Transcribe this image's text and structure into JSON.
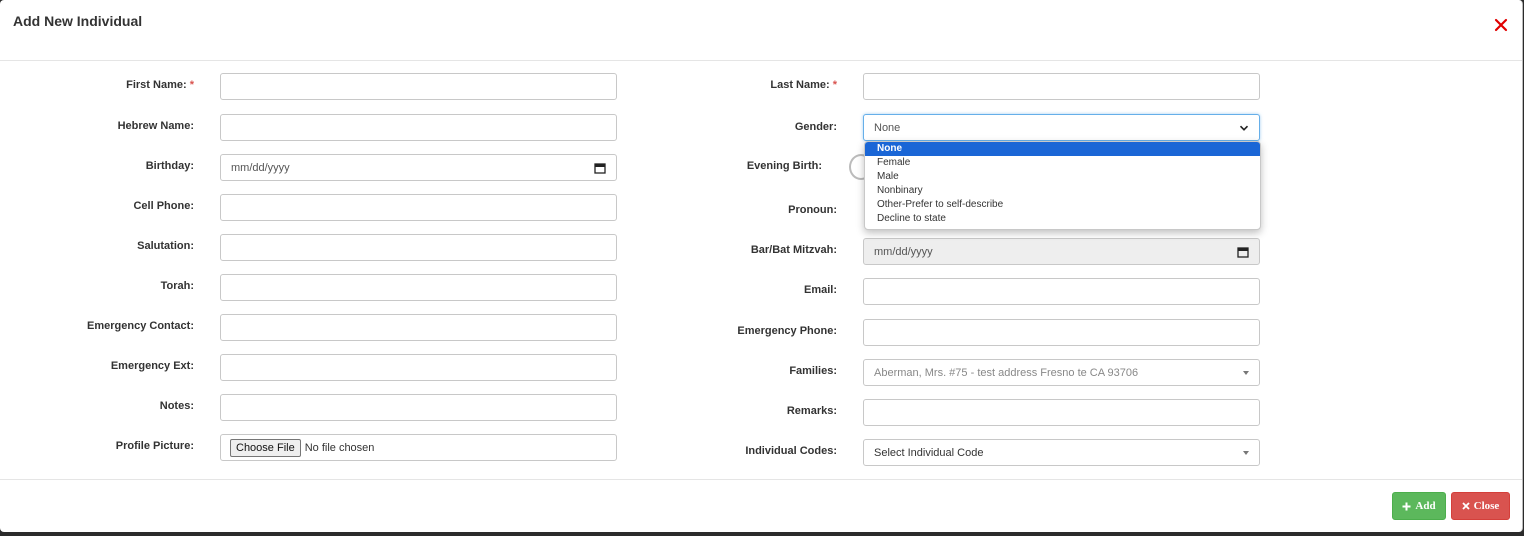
{
  "modal": {
    "title": "Add New Individual",
    "required_mark": "*"
  },
  "left_fields": {
    "first_name": {
      "label": "First Name:",
      "value": ""
    },
    "hebrew_name": {
      "label": "Hebrew Name:",
      "value": ""
    },
    "birthday": {
      "label": "Birthday:",
      "placeholder": "mm/dd/yyyy"
    },
    "cell_phone": {
      "label": "Cell Phone:",
      "value": ""
    },
    "salutation": {
      "label": "Salutation:",
      "value": ""
    },
    "torah": {
      "label": "Torah:",
      "value": ""
    },
    "emergency_contact": {
      "label": "Emergency Contact:",
      "value": ""
    },
    "emergency_ext": {
      "label": "Emergency Ext:",
      "value": ""
    },
    "notes": {
      "label": "Notes:",
      "value": ""
    },
    "profile_picture": {
      "label": "Profile Picture:",
      "button": "Choose File",
      "status": "No file chosen"
    }
  },
  "right_fields": {
    "last_name": {
      "label": "Last Name:",
      "value": ""
    },
    "gender": {
      "label": "Gender:",
      "selected": "None",
      "options": [
        "None",
        "Female",
        "Male",
        "Nonbinary",
        "Other-Prefer to self-describe",
        "Decline to state"
      ]
    },
    "evening_birth": {
      "label": "Evening Birth:"
    },
    "pronoun": {
      "label": "Pronoun:"
    },
    "bar_bat_mitzvah": {
      "label": "Bar/Bat Mitzvah:",
      "placeholder": "mm/dd/yyyy"
    },
    "email": {
      "label": "Email:",
      "value": ""
    },
    "emergency_phone": {
      "label": "Emergency Phone:",
      "value": ""
    },
    "families": {
      "label": "Families:",
      "value": "Aberman, Mrs. #75 - test address Fresno te CA 93706"
    },
    "remarks": {
      "label": "Remarks:",
      "value": ""
    },
    "individual_codes": {
      "label": "Individual Codes:",
      "placeholder": "Select Individual Code"
    }
  },
  "footer": {
    "add_label": "Add",
    "close_label": "Close"
  },
  "icons": {
    "close": "close-x-icon",
    "add": "plus-icon",
    "close_button": "times-icon",
    "calendar": "calendar-icon",
    "chevron": "chevron-down-icon",
    "caret": "caret-down-icon"
  },
  "colors": {
    "add_button": "#5cb85c",
    "close_button": "#d9534f",
    "required": "#d9534f",
    "selected_option": "#1a66d6",
    "close_x": "#e00000"
  }
}
